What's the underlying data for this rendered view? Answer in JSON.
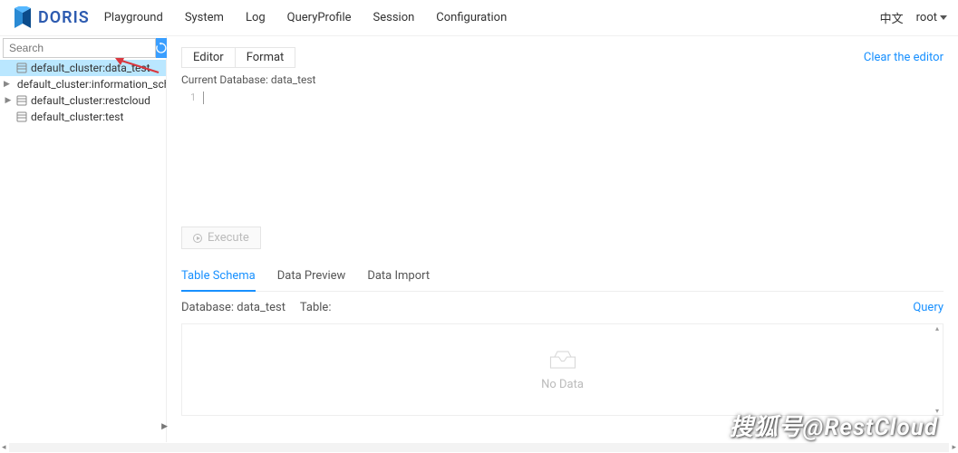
{
  "header": {
    "logo_text": "DORIS",
    "nav": [
      "Playground",
      "System",
      "Log",
      "QueryProfile",
      "Session",
      "Configuration"
    ],
    "lang": "中文",
    "user": "root"
  },
  "sidebar": {
    "search_placeholder": "Search",
    "items": [
      {
        "label": "default_cluster:data_test",
        "expandable": false,
        "selected": true
      },
      {
        "label": "default_cluster:information_schema",
        "expandable": true,
        "selected": false
      },
      {
        "label": "default_cluster:restcloud",
        "expandable": true,
        "selected": false
      },
      {
        "label": "default_cluster:test",
        "expandable": false,
        "selected": false
      }
    ]
  },
  "editor": {
    "tabs": [
      "Editor",
      "Format"
    ],
    "clear": "Clear the editor",
    "current_db_label": "Current Database: ",
    "current_db": "data_test",
    "line_no": "1",
    "execute": "Execute"
  },
  "results": {
    "tabs": [
      "Table Schema",
      "Data Preview",
      "Data Import"
    ],
    "active_tab": 0,
    "db_label": "Database: ",
    "db_value": "data_test",
    "table_label": "Table:",
    "table_value": "",
    "query_link": "Query",
    "no_data": "No Data"
  },
  "watermark": "搜狐号@RestCloud"
}
